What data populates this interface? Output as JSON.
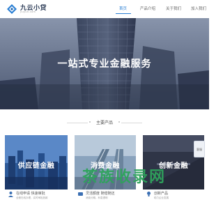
{
  "header": {
    "logo_text": "九云小贷",
    "logo_sub": "jiuyun.com",
    "nav": [
      {
        "label": "首页",
        "active": true
      },
      {
        "label": "产品介绍",
        "active": false
      },
      {
        "label": "关于我们",
        "active": false
      },
      {
        "label": "加入我们",
        "active": false
      }
    ]
  },
  "hero": {
    "title": "一站式专业金融服务"
  },
  "section": {
    "title": "主要产品"
  },
  "cards": [
    {
      "label": "供应链金融",
      "foot_title": "在线申请 快速审批",
      "foot_sub": "全程在线办理，实时审批放款"
    },
    {
      "label": "消费金融",
      "foot_title": "灵活额度 随借随还",
      "foot_sub": "消费分期，利息透明"
    },
    {
      "label": "创新金融",
      "foot_title": "创新产品",
      "foot_sub": "助力企业发展"
    }
  ],
  "side_float": {
    "label": "客服"
  },
  "watermark": {
    "text": "茶族收录网"
  },
  "colors": {
    "accent": "#2a7fd4",
    "brand_dark": "#2a3a55",
    "watermark": "#2ea35c"
  }
}
